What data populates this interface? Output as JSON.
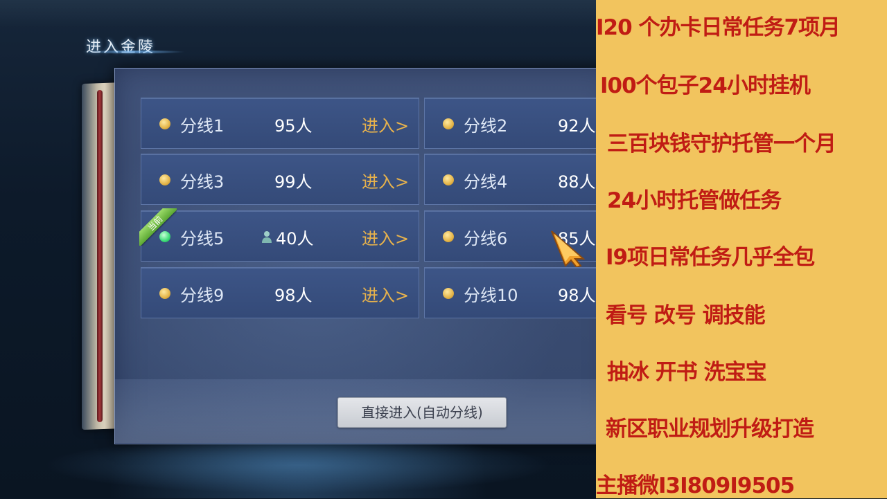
{
  "dialog": {
    "title": "进入金陵",
    "auto_button_label": "直接进入(自动分线)",
    "current_tag": "当前",
    "enter_label": "进入>"
  },
  "servers": [
    {
      "name": "分线1",
      "count": "95人",
      "status": "normal"
    },
    {
      "name": "分线2",
      "count": "92人",
      "status": "normal"
    },
    {
      "name": "分线3",
      "count": "99人",
      "status": "normal"
    },
    {
      "name": "分线4",
      "count": "88人",
      "status": "normal"
    },
    {
      "name": "分线5",
      "count": "40人",
      "status": "current"
    },
    {
      "name": "分线6",
      "count": "85人",
      "status": "normal"
    },
    {
      "name": "分线9",
      "count": "98人",
      "status": "normal"
    },
    {
      "name": "分线10",
      "count": "98人",
      "status": "normal"
    }
  ],
  "ad": {
    "lines": [
      "I20 个办卡日常任务7项月",
      "I00个包子24小时挂机",
      "三百块钱守护托管一个月",
      "24小时托管做任务",
      "I9项日常任务几乎全包",
      "看号  改号  调技能",
      "抽冰 开书 洗宝宝",
      "新区职业规划升级打造",
      "主播微I3I809I9505"
    ]
  },
  "colors": {
    "ad_background": "#f2c45e",
    "ad_text": "#c01c14",
    "enter_text": "#e7b24c",
    "status_normal": "#e4b448",
    "status_current": "#3ddc78"
  }
}
